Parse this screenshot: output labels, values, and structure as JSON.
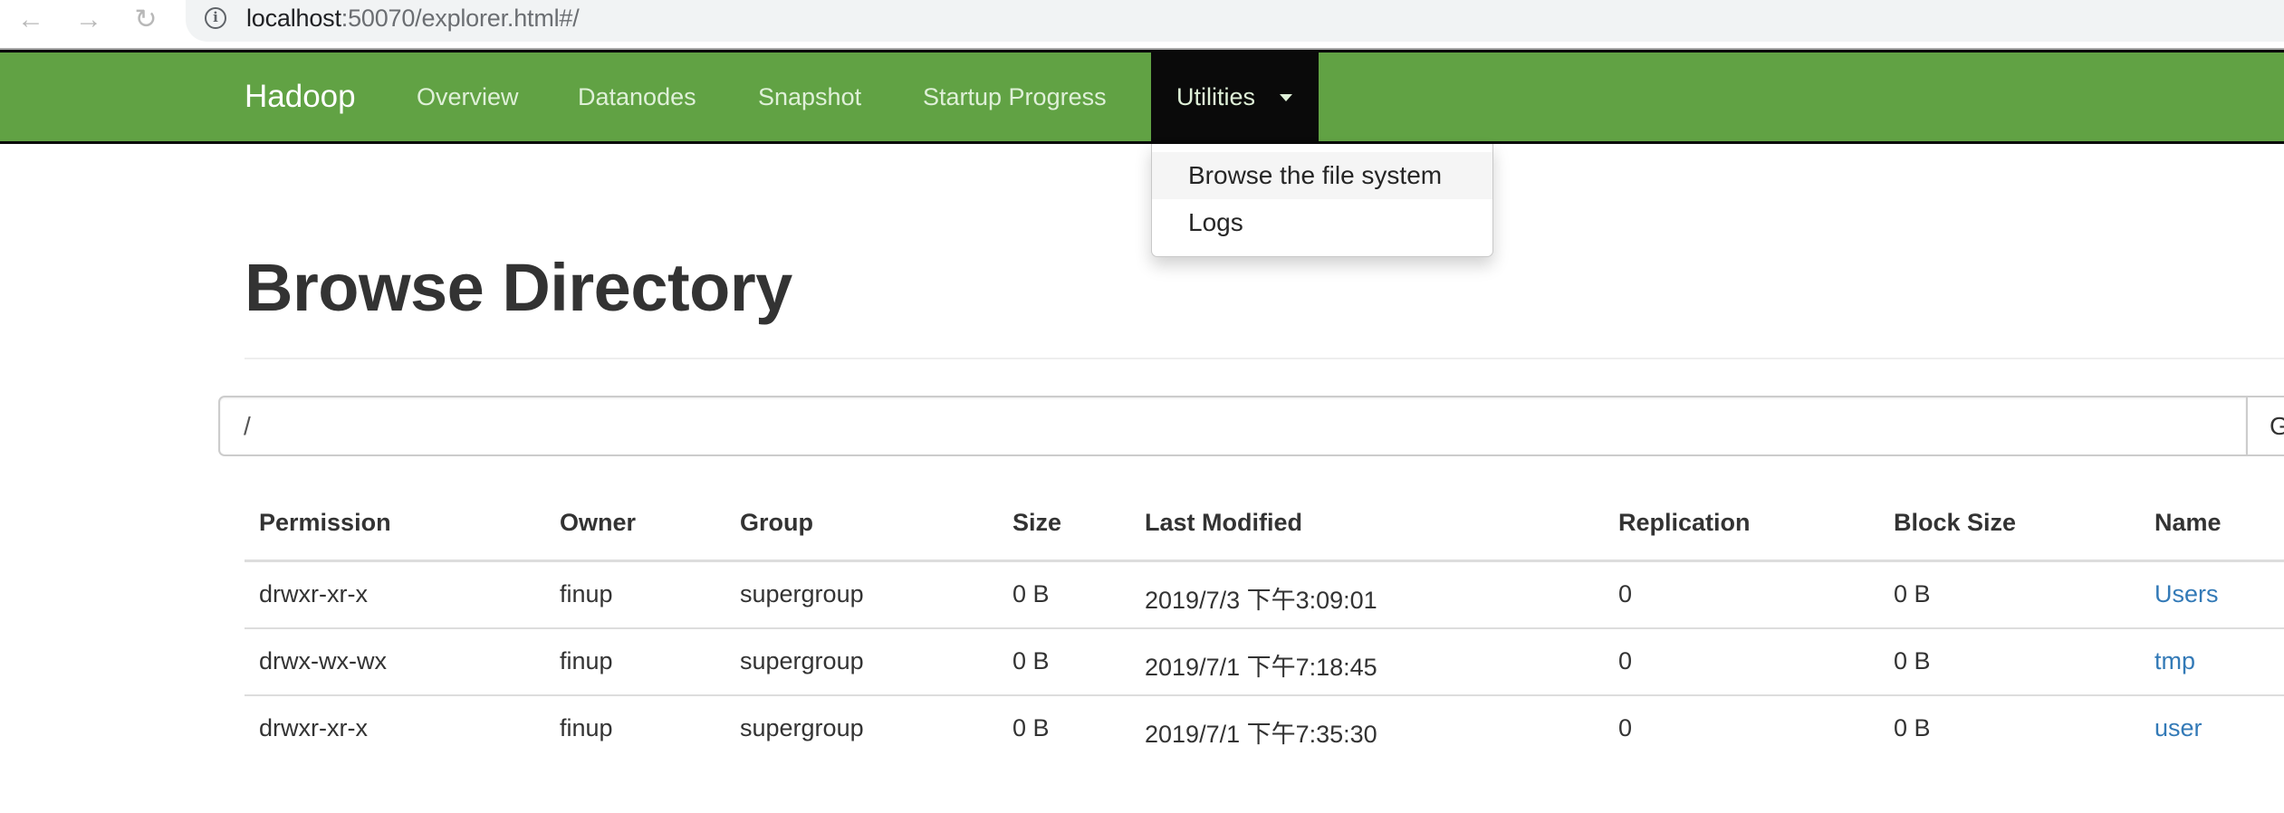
{
  "browser": {
    "url_host": "localhost",
    "url_rest": ":50070/explorer.html#/",
    "back_icon": "←",
    "forward_icon": "→",
    "reload_icon": "↻",
    "info_icon": "i"
  },
  "navbar": {
    "brand": "Hadoop",
    "items": [
      {
        "label": "Overview"
      },
      {
        "label": "Datanodes"
      },
      {
        "label": "Snapshot"
      },
      {
        "label": "Startup Progress"
      }
    ],
    "active": {
      "label": "Utilities"
    },
    "colors": {
      "background": "#61a244",
      "active_background": "#0a0a0a",
      "link": "#dff0d8"
    }
  },
  "dropdown": {
    "items": [
      {
        "label": "Browse the file system",
        "highlighted": true
      },
      {
        "label": "Logs",
        "highlighted": false
      }
    ]
  },
  "main": {
    "title": "Browse Directory",
    "path_input": {
      "value": "/"
    },
    "go_button": "Go!"
  },
  "table": {
    "headers": [
      "Permission",
      "Owner",
      "Group",
      "Size",
      "Last Modified",
      "Replication",
      "Block Size",
      "Name"
    ],
    "rows": [
      [
        "drwxr-xr-x",
        "finup",
        "supergroup",
        "0 B",
        "2019/7/3 下午3:09:01",
        "0",
        "0 B",
        "Users"
      ],
      [
        "drwx-wx-wx",
        "finup",
        "supergroup",
        "0 B",
        "2019/7/1 下午7:18:45",
        "0",
        "0 B",
        "tmp"
      ],
      [
        "drwxr-xr-x",
        "finup",
        "supergroup",
        "0 B",
        "2019/7/1 下午7:35:30",
        "0",
        "0 B",
        "user"
      ]
    ],
    "link_color": "#337ab7"
  }
}
